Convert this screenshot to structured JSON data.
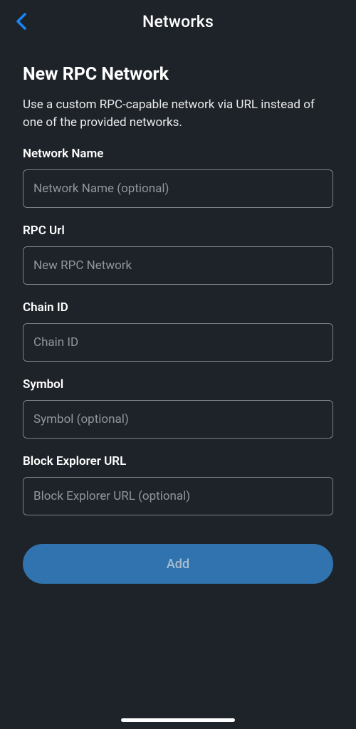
{
  "header": {
    "title": "Networks"
  },
  "page": {
    "title": "New RPC Network",
    "description": "Use a custom RPC-capable network via URL instead of one of the provided networks."
  },
  "fields": {
    "networkName": {
      "label": "Network Name",
      "placeholder": "Network Name (optional)"
    },
    "rpcUrl": {
      "label": "RPC Url",
      "placeholder": "New RPC Network"
    },
    "chainId": {
      "label": "Chain ID",
      "placeholder": "Chain ID"
    },
    "symbol": {
      "label": "Symbol",
      "placeholder": "Symbol (optional)"
    },
    "blockExplorerUrl": {
      "label": "Block Explorer URL",
      "placeholder": "Block Explorer URL (optional)"
    }
  },
  "actions": {
    "addLabel": "Add"
  }
}
